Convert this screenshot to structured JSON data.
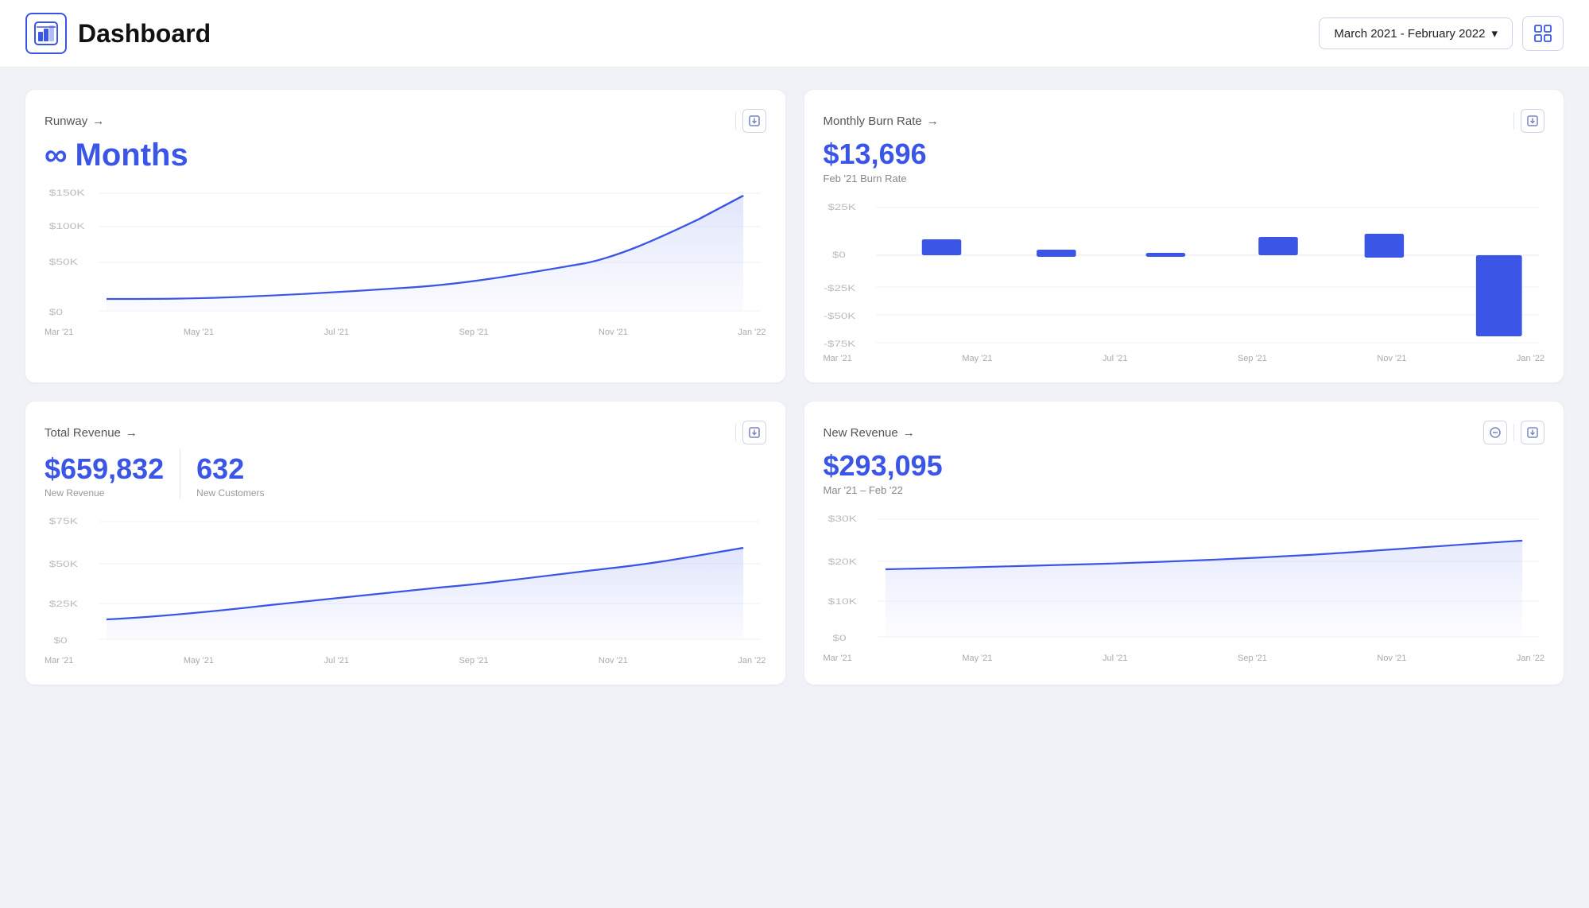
{
  "header": {
    "title": "Dashboard",
    "date_range": "March 2021 - February 2022",
    "chevron": "▾"
  },
  "cards": {
    "runway": {
      "title": "Runway",
      "metric": "∞ Months",
      "infinity_symbol": "∞",
      "months_label": "Months",
      "y_labels": [
        "$150K",
        "$100K",
        "$50K",
        "$0"
      ],
      "x_labels": [
        "Mar '21",
        "May '21",
        "Jul '21",
        "Sep '21",
        "Nov '21",
        "Jan '22"
      ]
    },
    "burn_rate": {
      "title": "Monthly Burn Rate",
      "metric": "$13,696",
      "subtitle": "Feb '21 Burn Rate",
      "y_labels": [
        "$25K",
        "$0",
        "-$25K",
        "-$50K",
        "-$75K"
      ],
      "x_labels": [
        "Mar '21",
        "May '21",
        "Jul '21",
        "Sep '21",
        "Nov '21",
        "Jan '22"
      ]
    },
    "total_revenue": {
      "title": "Total Revenue",
      "metric": "$659,832",
      "sub_metric": "632",
      "metric_label": "New Revenue",
      "sub_metric_label": "New Customers",
      "y_labels": [
        "$75K",
        "$50K",
        "$25K",
        "$0"
      ],
      "x_labels": [
        "Mar '21",
        "May '21",
        "Jul '21",
        "Sep '21",
        "Nov '21",
        "Jan '22"
      ]
    },
    "new_revenue": {
      "title": "New Revenue",
      "metric": "$293,095",
      "subtitle": "Mar '21 – Feb '22",
      "y_labels": [
        "$30K",
        "$20K",
        "$10K",
        "$0"
      ],
      "x_labels": [
        "Mar '21",
        "May '21",
        "Jul '21",
        "Sep '21",
        "Nov '21",
        "Jan '22"
      ]
    }
  },
  "icons": {
    "dashboard": "📊",
    "download": "⊞",
    "grid": "⊞",
    "arrow": "→",
    "circle_minus": "⊖"
  }
}
